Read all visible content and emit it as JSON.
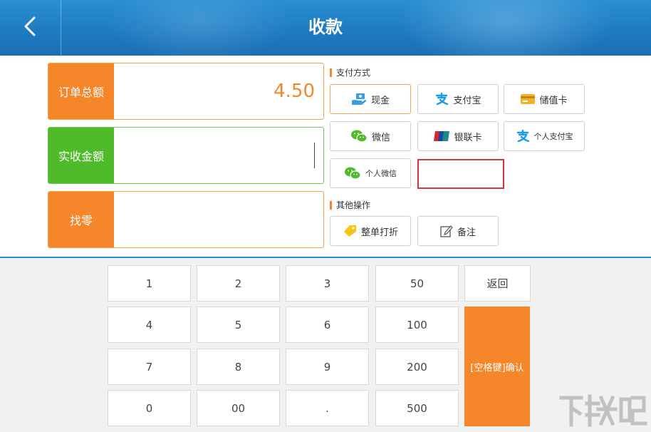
{
  "header": {
    "title": "收款",
    "back_icon": "chevron-left-icon"
  },
  "amounts": {
    "total_label": "订单总额",
    "total_value": "4.50",
    "received_label": "实收金额",
    "received_value": "",
    "change_label": "找零",
    "change_value": ""
  },
  "payment": {
    "title": "支付方式",
    "methods": [
      {
        "label": "现金",
        "icon": "cash-hand-icon"
      },
      {
        "label": "支付宝",
        "icon": "alipay-icon"
      },
      {
        "label": "储值卡",
        "icon": "stored-value-card-icon"
      },
      {
        "label": "微信",
        "icon": "wechat-icon"
      },
      {
        "label": "银联卡",
        "icon": "unionpay-icon"
      },
      {
        "label": "个人支付宝",
        "icon": "alipay-icon"
      },
      {
        "label": "个人微信",
        "icon": "wechat-icon"
      }
    ],
    "selected": "现金"
  },
  "other": {
    "title": "其他操作",
    "actions": [
      {
        "label": "整单打折",
        "icon": "discount-tag-icon"
      },
      {
        "label": "备注",
        "icon": "note-edit-icon"
      }
    ]
  },
  "keypad": {
    "keys": [
      "1",
      "2",
      "3",
      "50",
      "4",
      "5",
      "6",
      "100",
      "7",
      "8",
      "9",
      "200",
      "0",
      "00",
      ".",
      "500"
    ],
    "back_label": "返回",
    "confirm_label": "[空格键]确认"
  },
  "colors": {
    "header_blue": "#1f7bc0",
    "orange": "#f5862a",
    "green": "#4fbb2a",
    "selection_red": "#d9343a"
  },
  "watermark": "下载吧"
}
